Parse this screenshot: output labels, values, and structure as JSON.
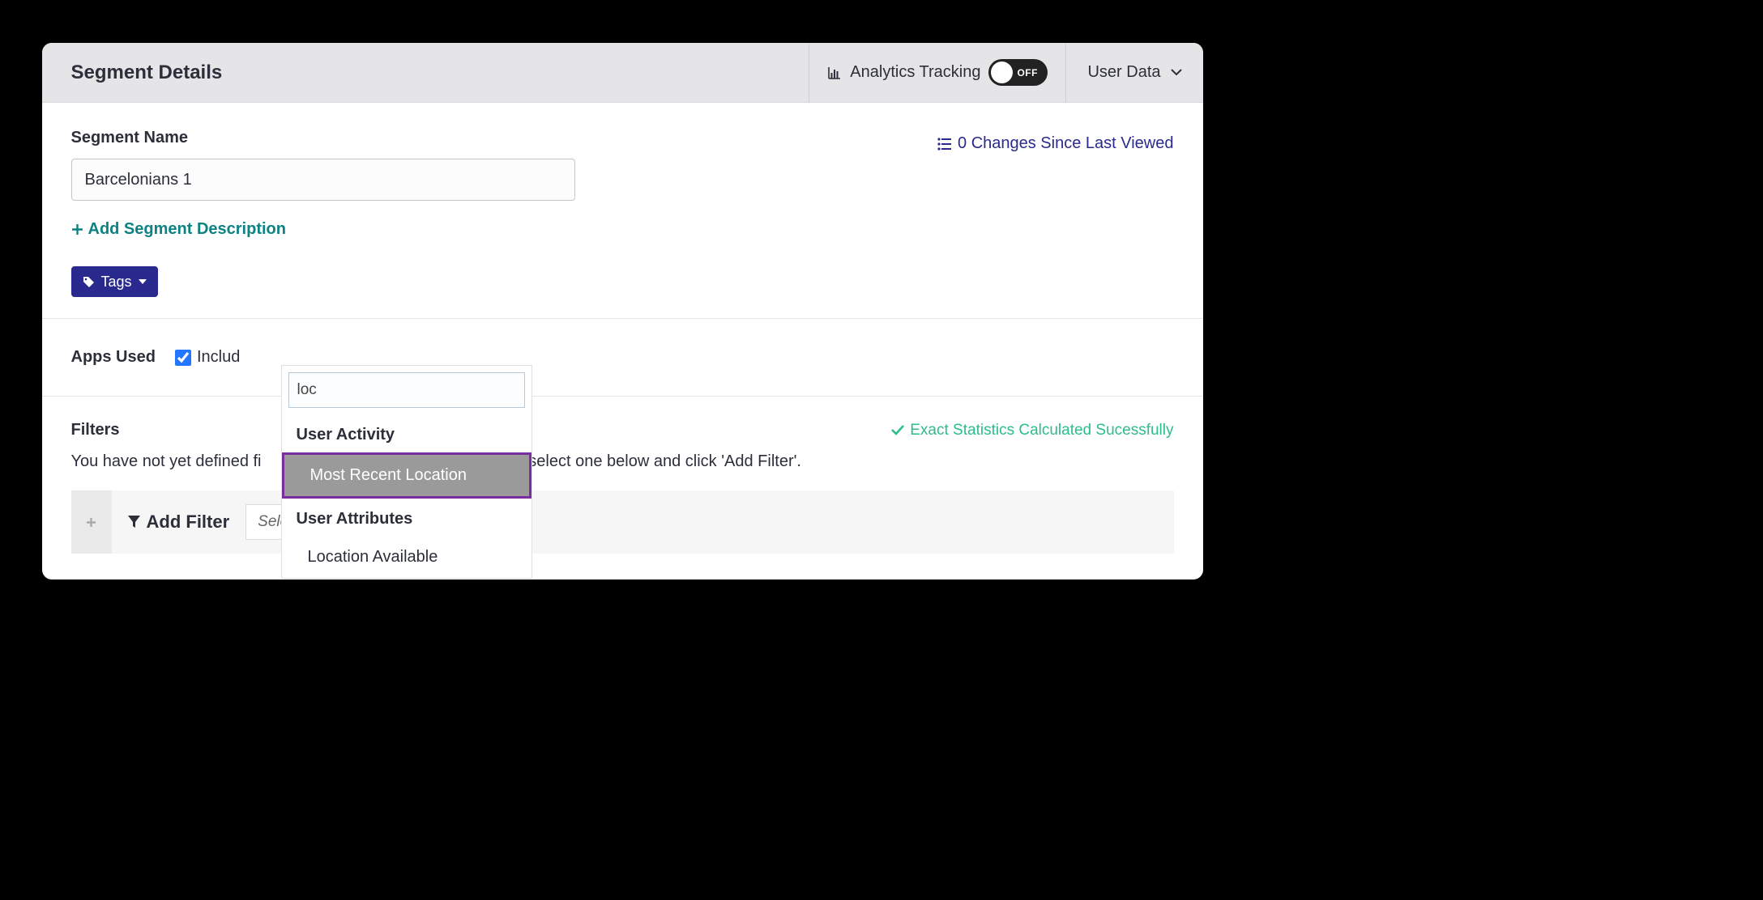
{
  "header": {
    "title": "Segment Details",
    "analytics_label": "Analytics Tracking",
    "toggle_state": "OFF",
    "user_data_label": "User Data"
  },
  "segment": {
    "name_label": "Segment Name",
    "name_value": "Barcelonians 1",
    "changes_link": "0 Changes Since Last Viewed",
    "add_description_label": "Add Segment Description",
    "tags_label": "Tags"
  },
  "apps": {
    "label": "Apps Used",
    "include_label": "Includ",
    "include_checked": true
  },
  "filters": {
    "title": "Filters",
    "stats_ok": "Exact Statistics Calculated Sucessfully",
    "description_prefix": "You have not yet defined fi",
    "description_suffix": "r, select one below and click 'Add Filter'.",
    "add_filter_label": "Add Filter",
    "select_placeholder": "Select Filter..."
  },
  "dropdown": {
    "search_value": "loc",
    "groups": [
      {
        "label": "User Activity",
        "items": [
          {
            "label": "Most Recent Location",
            "highlighted": true
          }
        ]
      },
      {
        "label": "User Attributes",
        "items": [
          {
            "label": "Location Available",
            "highlighted": false
          }
        ]
      }
    ]
  }
}
